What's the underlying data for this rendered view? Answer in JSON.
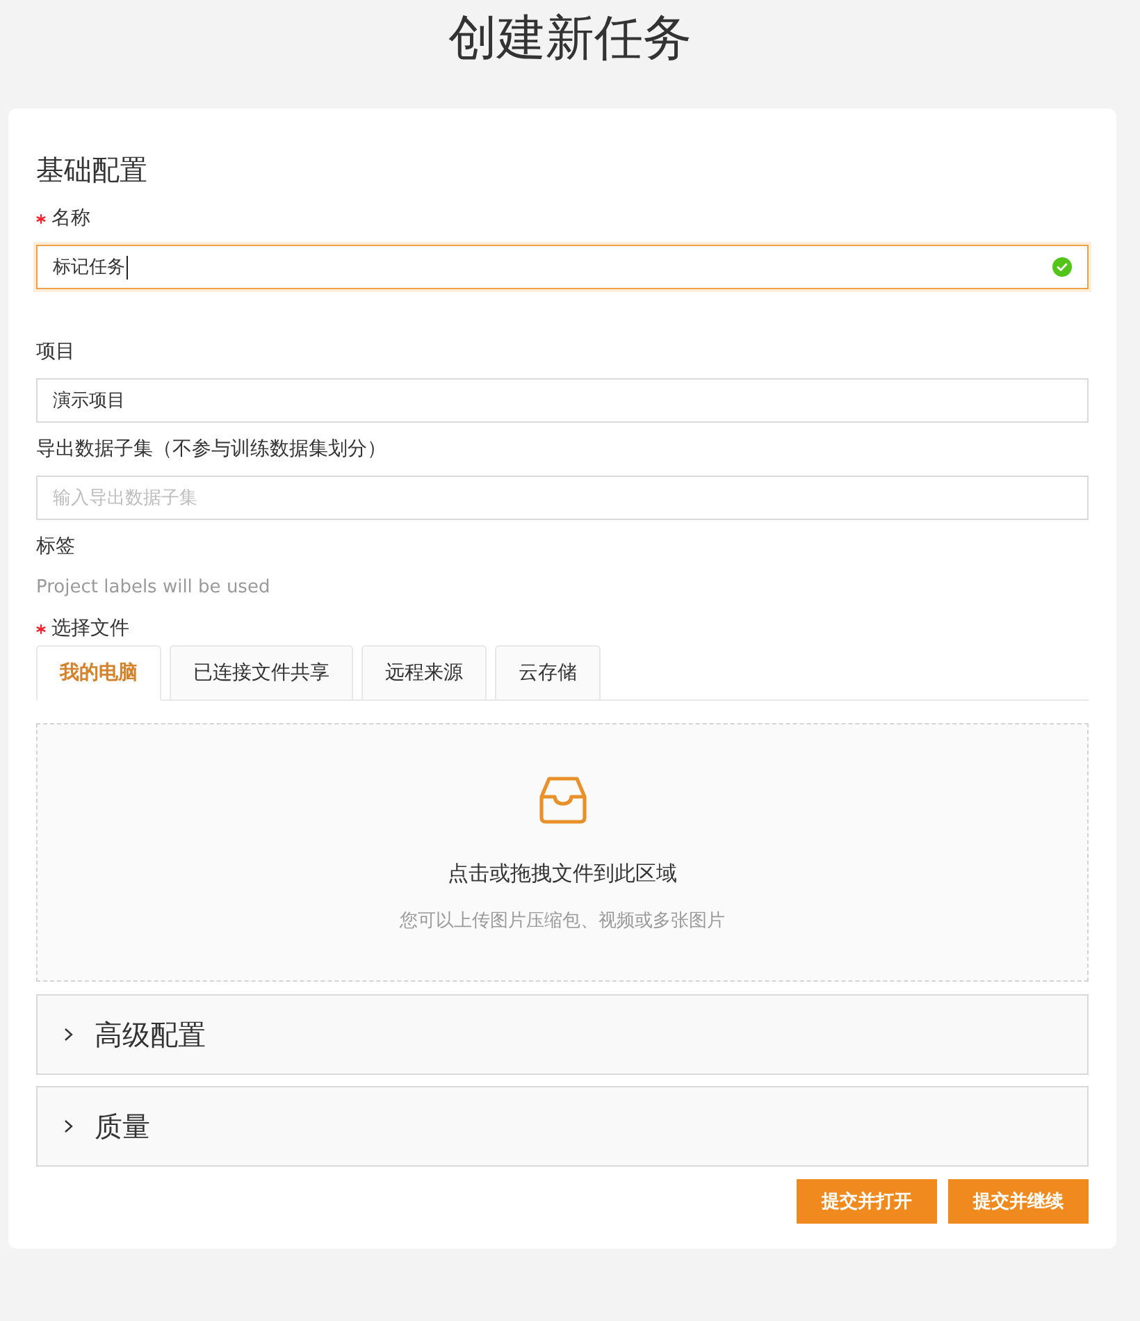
{
  "page_title": "创建新任务",
  "section_title": "基础配置",
  "fields": [
    {
      "label": "名称",
      "required": true,
      "value": "标记任务",
      "focused": true,
      "valid": true
    },
    {
      "label": "项目",
      "required": false,
      "value": "演示项目",
      "focused": false,
      "valid": false
    },
    {
      "label": "导出数据子集（不参与训练数据集划分）",
      "required": false,
      "placeholder": "输入导出数据子集",
      "focused": false,
      "valid": false
    }
  ],
  "labels": {
    "label": "标签",
    "note": "Project labels will be used"
  },
  "file_select": {
    "label": "选择文件",
    "required": true,
    "tabs": [
      {
        "label": "我的电脑",
        "selected": true
      },
      {
        "label": "已连接文件共享",
        "selected": false
      },
      {
        "label": "远程来源",
        "selected": false
      },
      {
        "label": "云存储",
        "selected": false
      }
    ],
    "dropzone": {
      "title": "点击或拖拽文件到此区域",
      "hint": "您可以上传图片压缩包、视频或多张图片"
    }
  },
  "panels": [
    {
      "title": "高级配置",
      "expanded": false
    },
    {
      "title": "质量",
      "expanded": false
    }
  ],
  "buttons": [
    "提交并打开",
    "提交并继续"
  ]
}
